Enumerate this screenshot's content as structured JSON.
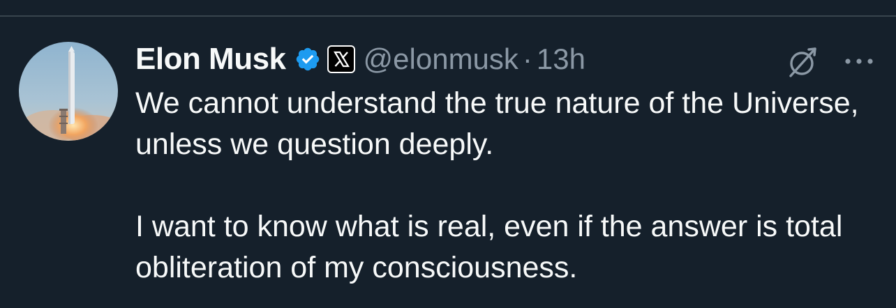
{
  "colors": {
    "background": "#15202b",
    "text_primary": "#f7f9f9",
    "text_secondary": "#8b98a5",
    "verified_blue": "#1d9bf0",
    "divider": "#38444d"
  },
  "tweet": {
    "author": {
      "display_name": "Elon Musk",
      "handle": "@elonmusk",
      "avatar_icon": "rocket-launch-avatar",
      "verified_icon": "verified-badge-icon",
      "affiliate_icon": "x-logo-affiliate-icon"
    },
    "separator": "·",
    "time": "13h",
    "actions": {
      "grok_icon": "grok-icon",
      "more_icon": "more-options-icon"
    },
    "paragraphs": [
      "We cannot understand the true nature of the Universe, unless we question deeply.",
      "I want to know what is real, even if the answer is total obliteration of my consciousness."
    ]
  }
}
